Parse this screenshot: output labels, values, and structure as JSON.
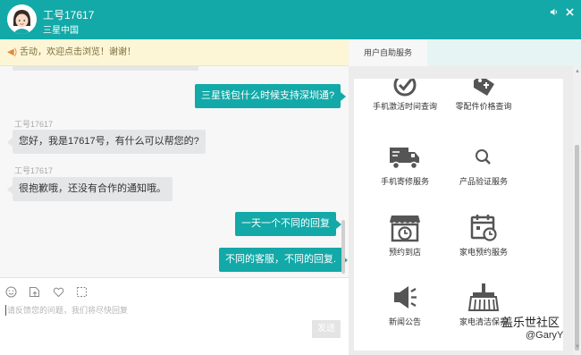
{
  "header": {
    "agent_name": "工号17617",
    "agent_org": "三星中国",
    "sound_icon": "speaker-icon",
    "close_icon": "close-icon"
  },
  "notice": {
    "text": "舌动，欢迎点击浏览！谢谢！"
  },
  "chat": {
    "messages": [
      {
        "dir": "out",
        "text": "三星钱包什么时候支持深圳通?"
      },
      {
        "dir": "in",
        "sender": "工号17617",
        "text": "您好，我是17617号，有什么可以帮您的?"
      },
      {
        "dir": "in",
        "sender": "工号17617",
        "text": "很抱歉哦，还没有合作的通知哦。"
      },
      {
        "dir": "out",
        "text": "一天一个不同的回复"
      },
      {
        "dir": "out",
        "text": "不同的客服，不同的回复."
      }
    ]
  },
  "input": {
    "placeholder": "请反馈您的问题，我们将尽快回复",
    "send_label": "发送",
    "toolbar_icons": [
      "emoji-icon",
      "file-icon",
      "heart-icon",
      "screenshot-icon"
    ]
  },
  "right_panel": {
    "tab_label": "用户自助服务",
    "services": [
      {
        "label": "手机激活时间查询",
        "icon": "activation-check-icon"
      },
      {
        "label": "零配件价格查询",
        "icon": "price-tag-icon"
      },
      {
        "label": "手机寄修服务",
        "icon": "delivery-truck-icon"
      },
      {
        "label": "产品验证服务",
        "icon": "magnifier-icon"
      },
      {
        "label": "预约到店",
        "icon": "store-clock-icon"
      },
      {
        "label": "家电预约服务",
        "icon": "calendar-clock-icon"
      },
      {
        "label": "新闻公告",
        "icon": "megaphone-icon"
      },
      {
        "label": "家电清洁保养",
        "icon": "cleaning-brush-icon"
      }
    ]
  },
  "watermark": {
    "title": "盖乐世社区",
    "user": "@GaryY"
  },
  "colors": {
    "primary": "#13a9a8",
    "notice_bg": "#fdf6d6",
    "bubble_in": "#e5e6e8",
    "icon_gray": "#555555"
  }
}
